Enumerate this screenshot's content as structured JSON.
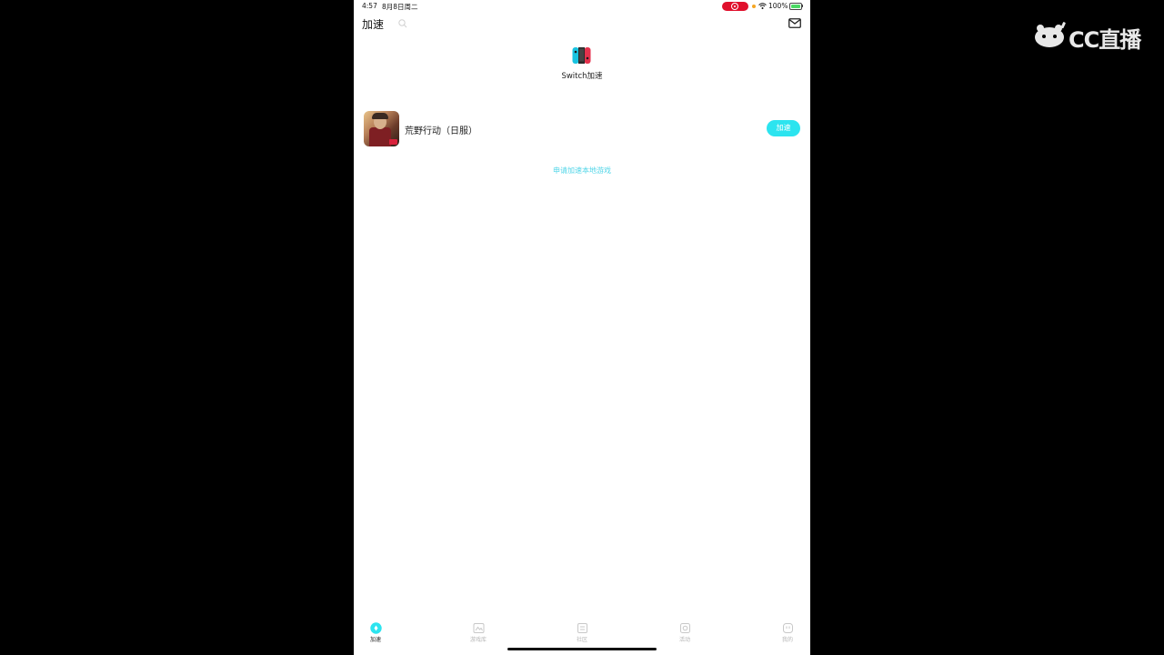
{
  "status_bar": {
    "time": "4:57",
    "date": "8月8日周二",
    "battery_text": "100%"
  },
  "header": {
    "title": "加速"
  },
  "switch": {
    "label": "Switch加速"
  },
  "games": [
    {
      "name": "荒野行动（日服）",
      "button_label": "加速"
    }
  ],
  "apply_link": "申请加速本地游戏",
  "tabs": [
    {
      "label": "加速",
      "icon": "speed-icon",
      "active": true
    },
    {
      "label": "游戏库",
      "icon": "game-library-icon",
      "active": false
    },
    {
      "label": "社区",
      "icon": "community-icon",
      "active": false
    },
    {
      "label": "活动",
      "icon": "activity-icon",
      "active": false
    },
    {
      "label": "我的",
      "icon": "profile-icon",
      "active": false
    }
  ],
  "watermark": {
    "text": "CC直播"
  },
  "colors": {
    "accent": "#2ce4ef",
    "record": "#e0102c",
    "switch_left": "#19c3e0",
    "switch_right": "#e4324d"
  }
}
